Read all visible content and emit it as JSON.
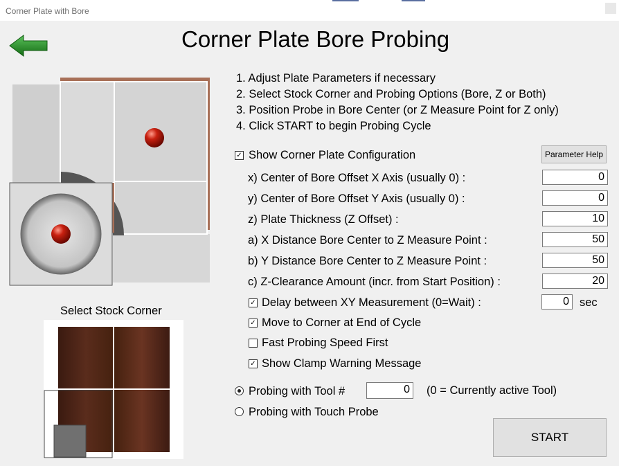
{
  "window": {
    "title": "Corner Plate with Bore"
  },
  "header": {
    "title": "Corner Plate Bore Probing"
  },
  "instructions": [
    "1. Adjust Plate Parameters if necessary",
    "2. Select Stock Corner and Probing Options (Bore, Z or Both)",
    "3. Position Probe in Bore Center (or Z Measure Point for Z only)",
    "4. Click START to begin Probing Cycle"
  ],
  "show_config": {
    "label": "Show Corner Plate Configuration",
    "checked": true
  },
  "parameter_help": {
    "label": "Parameter Help"
  },
  "params": [
    {
      "label": "x) Center of Bore Offset X Axis (usually 0) :",
      "value": "0"
    },
    {
      "label": "y) Center of Bore Offset Y Axis (usually 0) :",
      "value": "0"
    },
    {
      "label": "z) Plate Thickness (Z Offset)  :",
      "value": "10"
    },
    {
      "label": "a) X Distance Bore Center to Z Measure Point :",
      "value": "50"
    },
    {
      "label": "b) Y Distance Bore Center to Z Measure Point :",
      "value": "50"
    },
    {
      "label": "c) Z-Clearance Amount (incr. from Start Position)  :",
      "value": "20"
    }
  ],
  "options": {
    "delay": {
      "label": "Delay between XY Measurement (0=Wait) :",
      "checked": true,
      "value": "0",
      "unit": "sec"
    },
    "move_corner": {
      "label": "Move to Corner at End of Cycle",
      "checked": true
    },
    "fast_probe": {
      "label": "Fast Probing Speed First",
      "checked": false
    },
    "clamp_warning": {
      "label": "Show Clamp Warning Message",
      "checked": true
    }
  },
  "probing": {
    "tool": {
      "label": "Probing with Tool #",
      "value": "0",
      "note": "(0 = Currently active Tool)",
      "selected": true
    },
    "touch": {
      "label": "Probing with Touch Probe",
      "selected": false
    }
  },
  "stock_corner": {
    "label": "Select Stock Corner",
    "selected": "bottom-left"
  },
  "start": {
    "label": "START"
  },
  "colors": {
    "wood": "#4a2418",
    "copper": "#a87058",
    "plate": "#d4d4d4",
    "back_arrow": "#1f8a1f"
  }
}
